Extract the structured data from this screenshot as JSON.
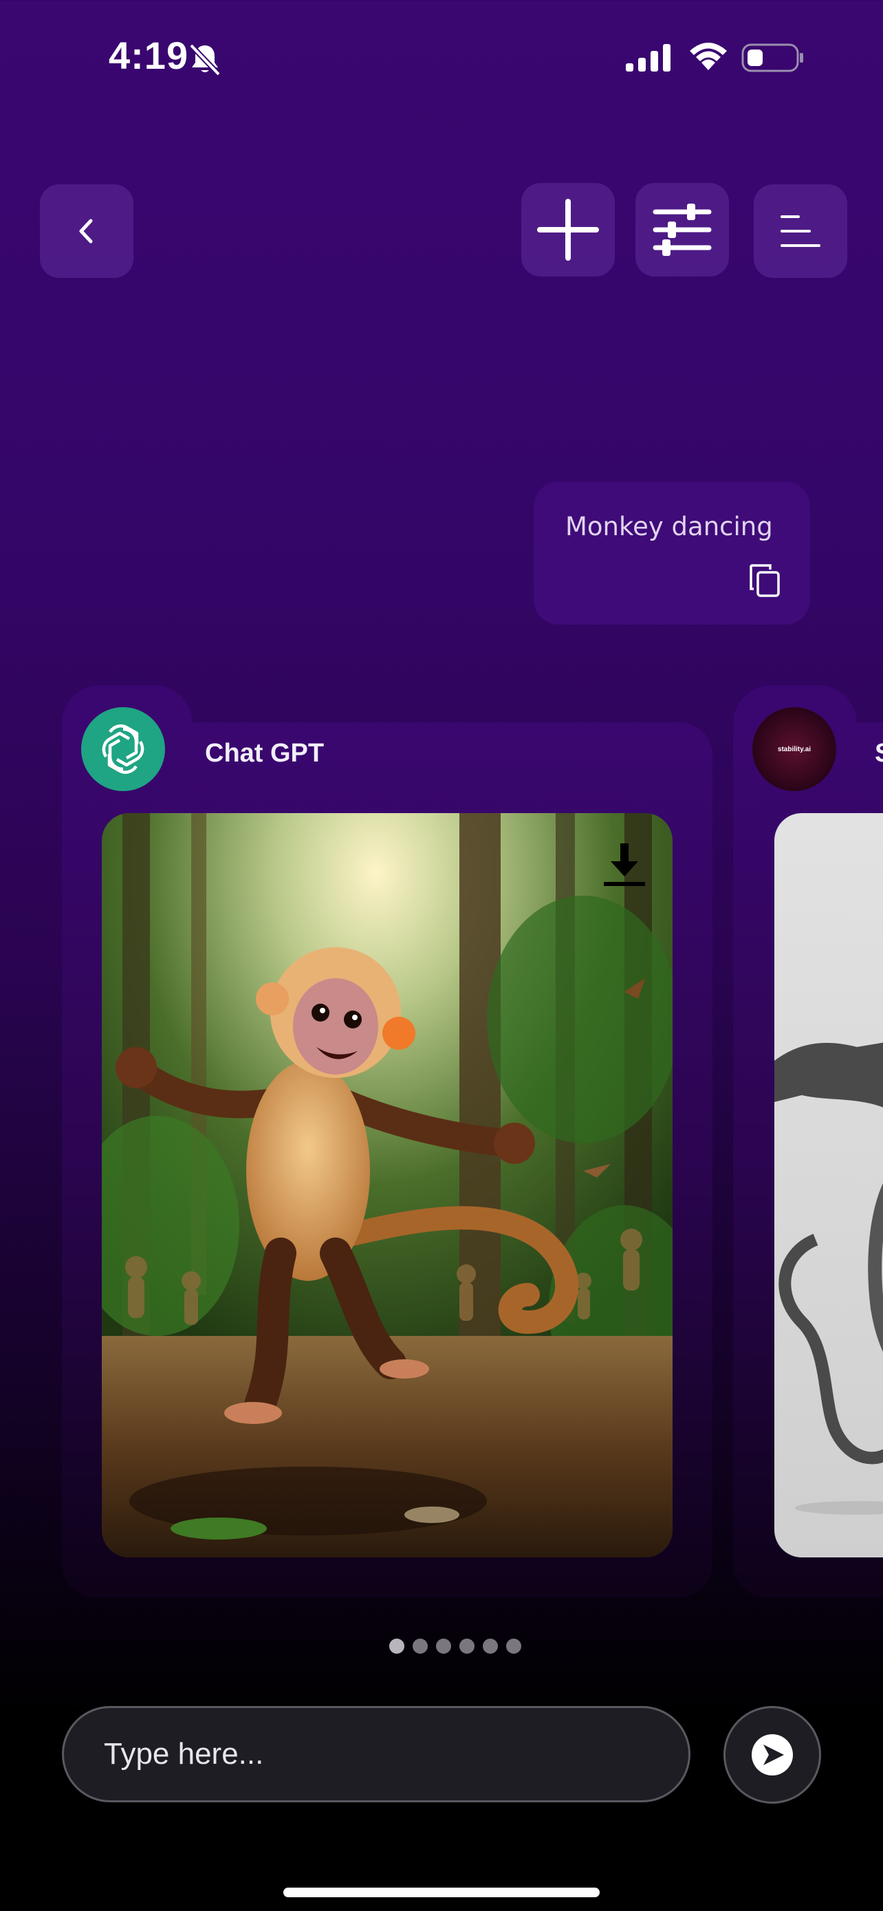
{
  "status_bar": {
    "time": "4:19",
    "icons": [
      "bell-slash-icon",
      "cellular-signal-icon",
      "wifi-icon",
      "battery-icon"
    ]
  },
  "toolbar": {
    "back_icon": "chevron-left-icon",
    "add_icon": "plus-icon",
    "filter_icon": "sliders-icon",
    "menu_icon": "menu-lines-icon"
  },
  "prompt": {
    "text": "Monkey dancing",
    "copy_icon": "copy-icon"
  },
  "cards": [
    {
      "provider": "Chat GPT",
      "logo_icon": "openai-logo-icon",
      "image": "dancing monkey in jungle",
      "download_icon": "download-icon"
    },
    {
      "provider": "S",
      "logo_icon": "stability-ai-logo-icon",
      "logo_text": "stability.ai",
      "image": "gray monkey figure"
    }
  ],
  "pagination": {
    "count": 6,
    "active_index": 0
  },
  "input": {
    "placeholder": "Type here..."
  },
  "send_icon": "send-icon",
  "colors": {
    "background_top": "#3a0670",
    "bubble": "#3f0b78",
    "card": "#3a0770",
    "chatgpt_logo": "#1fa583",
    "input_bg": "#1e1d23"
  }
}
